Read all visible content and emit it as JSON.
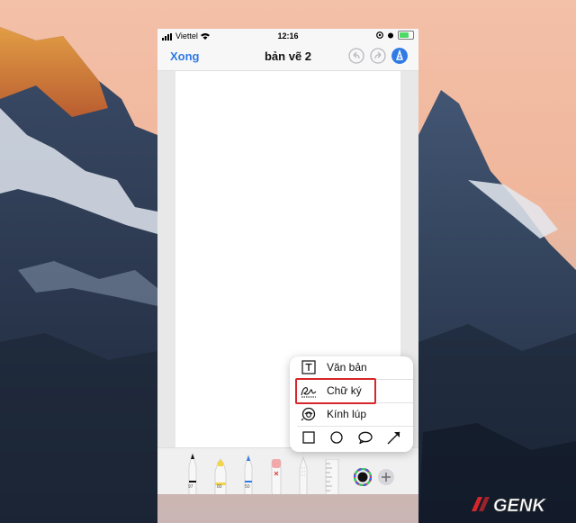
{
  "status_bar": {
    "carrier": "Viettel",
    "time": "12:16"
  },
  "nav": {
    "done_label": "Xong",
    "title": "bản vẽ 2",
    "undo_icon": "undo-icon",
    "redo_icon": "redo-icon",
    "markup_icon": "markup-pen-icon"
  },
  "tools": [
    {
      "name": "pen",
      "label": "97"
    },
    {
      "name": "highlighter",
      "label": "80"
    },
    {
      "name": "pencil",
      "label": "50"
    },
    {
      "name": "eraser",
      "label": ""
    },
    {
      "name": "lasso",
      "label": ""
    },
    {
      "name": "ruler",
      "label": ""
    }
  ],
  "add_menu": {
    "items": [
      {
        "label": "Văn bản",
        "icon": "text-box-icon"
      },
      {
        "label": "Chữ ký",
        "icon": "signature-icon"
      },
      {
        "label": "Kính lúp",
        "icon": "magnifier-icon"
      }
    ],
    "shapes": [
      "square-icon",
      "circle-icon",
      "speech-bubble-icon",
      "arrow-icon"
    ]
  },
  "watermark": {
    "text": "GENK"
  },
  "colors": {
    "accent": "#2f7ae5",
    "highlight": "#d6262a",
    "sky_top": "#e7a98c",
    "mountain": "#2a3a52"
  }
}
